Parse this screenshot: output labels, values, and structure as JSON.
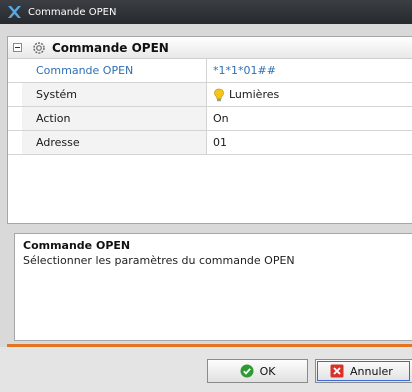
{
  "window": {
    "title": "Commande OPEN"
  },
  "panel": {
    "header_title": "Commande OPEN"
  },
  "properties": [
    {
      "label": "Commande OPEN",
      "value": "*1*1*01##",
      "icon": ""
    },
    {
      "label": "Systém",
      "value": "Lumières",
      "icon": "bulb-icon"
    },
    {
      "label": "Action",
      "value": "On",
      "icon": ""
    },
    {
      "label": "Adresse",
      "value": "01",
      "icon": ""
    }
  ],
  "description": {
    "title": "Commande OPEN",
    "text": "Sélectionner les paramètres du commande OPEN"
  },
  "buttons": {
    "ok_label": "OK",
    "cancel_label": "Annuler"
  },
  "colors": {
    "accent": "#e27422",
    "selected_text": "#2f6fb4",
    "titlebar": "#2f3236"
  }
}
